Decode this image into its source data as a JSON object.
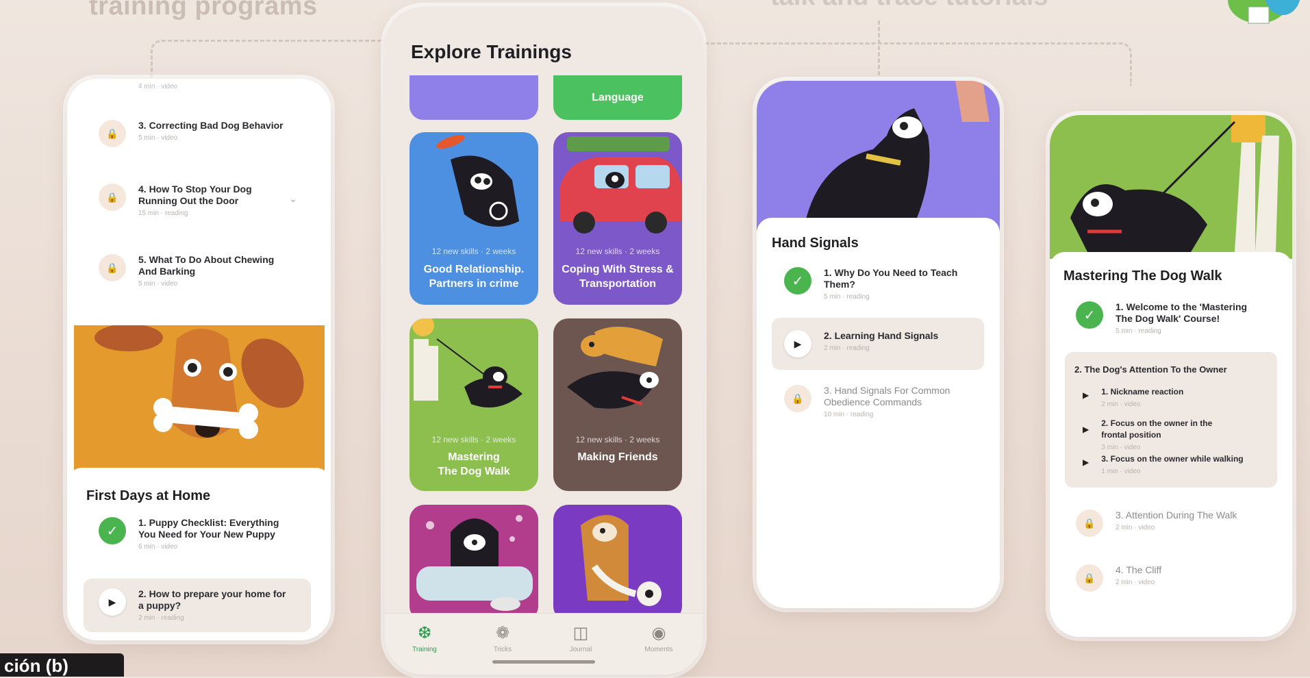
{
  "background": {
    "heading_left": "training programs",
    "heading_right": "talk and trace tutorials"
  },
  "phone1": {
    "top_meta": "4 min · video",
    "lessons": [
      {
        "title": "3. Correcting Bad Dog Behavior",
        "meta": "5 min · video"
      },
      {
        "title": "4. How To Stop Your Dog Running Out the Door",
        "meta": "15 min · reading"
      },
      {
        "title": "5. What To Do About Chewing And Barking",
        "meta": "5 min · video"
      }
    ],
    "card_title": "First Days at Home",
    "card_lessons": [
      {
        "title": "1. Puppy Checklist: Everything You Need for Your New Puppy",
        "meta": "6 min · video"
      },
      {
        "title": "2. How to prepare your home for a puppy?",
        "meta": "2 min · reading"
      }
    ]
  },
  "phone2": {
    "title": "Explore Trainings",
    "top_tiles": [
      {
        "name": "",
        "color": "#8f7fe8"
      },
      {
        "name": "Language",
        "color": "#4cc160"
      }
    ],
    "tiles": [
      {
        "meta": "12 new skills · 2 weeks",
        "name": "Good Relationship. Partners in crime",
        "color": "#4d8fe0"
      },
      {
        "meta": "12 new skills · 2 weeks",
        "name": "Coping With Stress & Transportation",
        "color": "#7d58c9"
      },
      {
        "meta": "12 new skills · 2 weeks",
        "name": "Mastering The Dog Walk",
        "color": "#8cbf4d"
      },
      {
        "meta": "12 new skills · 2 weeks",
        "name": "Making Friends",
        "color": "#6e5650"
      },
      {
        "meta": "",
        "name": "",
        "color": "#b23d8d"
      },
      {
        "meta": "",
        "name": "",
        "color": "#7a3bc2"
      }
    ],
    "nav": [
      {
        "label": "Training",
        "icon": "training-icon"
      },
      {
        "label": "Tricks",
        "icon": "paw-icon"
      },
      {
        "label": "Journal",
        "icon": "journal-icon"
      },
      {
        "label": "Moments",
        "icon": "camera-icon"
      }
    ]
  },
  "phone3": {
    "card_title": "Hand Signals",
    "lessons": [
      {
        "title": "1. Why Do You Need to Teach Them?",
        "meta": "5 min · reading",
        "state": "done"
      },
      {
        "title": "2. Learning Hand Signals",
        "meta": "2 min · reading",
        "state": "play"
      },
      {
        "title": "3. Hand Signals For Common Obedience Commands",
        "meta": "10 min · reading",
        "state": "lock"
      }
    ]
  },
  "phone4": {
    "card_title": "Mastering The Dog Walk",
    "lesson1": {
      "title": "1. Welcome to the 'Mastering The Dog Walk' Course!",
      "meta": "5 min · reading"
    },
    "section": {
      "title": "2. The Dog's Attention To the Owner",
      "items": [
        {
          "title": "1. Nickname reaction",
          "meta": "2 min · video"
        },
        {
          "title": "2. Focus on the owner in the frontal position",
          "meta": "3 min · video"
        },
        {
          "title": "3. Focus on the owner while walking",
          "meta": "1 min · video"
        }
      ]
    },
    "lessons": [
      {
        "title": "3. Attention During The Walk",
        "meta": "2 min · video"
      },
      {
        "title": "4. The Cliff",
        "meta": "2 min · video"
      }
    ]
  },
  "overlay_label": "ción (b)"
}
